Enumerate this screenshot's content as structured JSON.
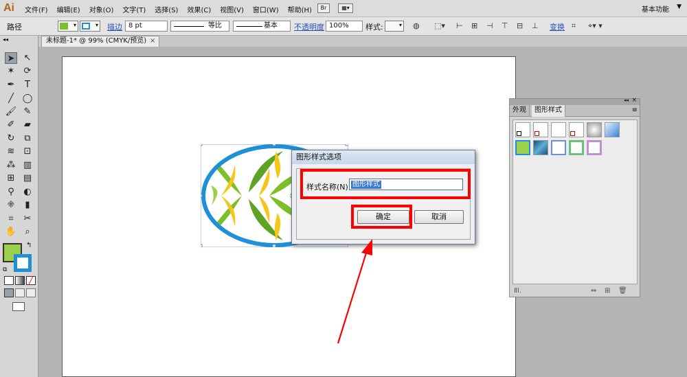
{
  "app": {
    "logo": "Ai",
    "workspace": "基本功能"
  },
  "menus": [
    "文件(F)",
    "编辑(E)",
    "对象(O)",
    "文字(T)",
    "选择(S)",
    "效果(C)",
    "视图(V)",
    "窗口(W)",
    "帮助(H)"
  ],
  "menubar_icons": {
    "bridge": "Br"
  },
  "control": {
    "object_type": "路径",
    "stroke_link": "描边",
    "stroke_weight": "8 pt",
    "profile_label": "等比",
    "brush_label": "基本",
    "opacity_link": "不透明度",
    "opacity_value": "100%",
    "style_label": "样式:",
    "transform_link": "变换"
  },
  "document_tab": {
    "title": "未标题-1* @ 99% (CMYK/预览)",
    "close": "×"
  },
  "dialog": {
    "title": "图形样式选项",
    "name_label": "样式名称(N):",
    "name_value": "图形样式",
    "ok_label": "确定",
    "cancel_label": "取消"
  },
  "panel": {
    "tabs": [
      "外观",
      "图形样式"
    ],
    "active_tab": "图形样式",
    "collapse_glyph": "◂◂",
    "close_glyph": "×",
    "menu_glyph": "≡"
  },
  "colors": {
    "highlight": "#ff0000",
    "egg_stroke": "#1e90d8",
    "leaf_green": "#7bbf2a",
    "leaf_yellow": "#f5c518",
    "selection": "#3a78d6"
  },
  "icons": [
    "select-arrow-icon",
    "direct-select-icon",
    "magic-wand-icon",
    "lasso-icon",
    "pen-icon",
    "type-icon",
    "line-icon",
    "ellipse-icon",
    "paintbrush-icon",
    "pencil-icon",
    "blob-brush-icon",
    "eraser-icon",
    "rotate-icon",
    "scale-icon",
    "warp-icon",
    "free-transform-icon",
    "symbol-sprayer-icon",
    "graph-icon",
    "mesh-icon",
    "gradient-icon",
    "eyedropper-icon",
    "blend-icon",
    "slice-icon",
    "scissors-icon",
    "hand-icon",
    "zoom-icon"
  ]
}
